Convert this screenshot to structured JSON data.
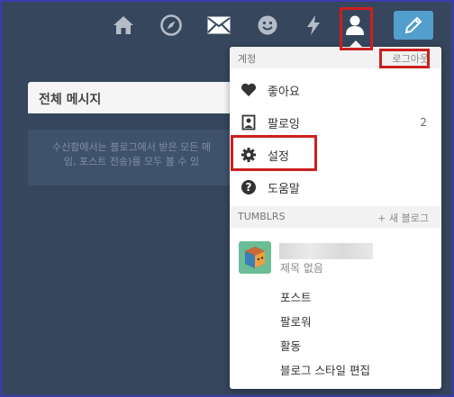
{
  "nav": {
    "icons": [
      "home-icon",
      "explore-compass-icon",
      "inbox-mail-icon",
      "messaging-smiley-icon",
      "activity-lightning-icon",
      "account-person-icon",
      "compose-pencil-icon"
    ]
  },
  "inbox": {
    "title": "전체 메시지",
    "message_line1": "수신함에서는 블로그에서 받은 모든 메",
    "message_line2": "임, 포스트 전송)를 모두 볼 수 있"
  },
  "dropdown": {
    "account_header": "계정",
    "logout": "로그아웃",
    "items": [
      {
        "label": "좋아요",
        "icon": "heart-icon",
        "count": ""
      },
      {
        "label": "팔로잉",
        "icon": "following-icon",
        "count": "2"
      },
      {
        "label": "설정",
        "icon": "gear-icon",
        "count": ""
      },
      {
        "label": "도움말",
        "icon": "help-icon",
        "count": ""
      }
    ],
    "tumblrs_header": "TUMBLRS",
    "new_blog": "+ 새 블로그",
    "blog": {
      "subtitle": "제목 없음",
      "links": [
        "포스트",
        "팔로워",
        "활동",
        "블로그 스타일 편집"
      ]
    }
  },
  "colors": {
    "background": "#36465d",
    "accent": "#529ecc",
    "highlight": "#cc1f1f"
  }
}
